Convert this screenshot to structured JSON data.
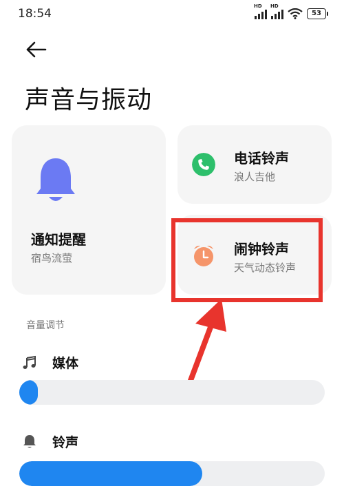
{
  "status_bar": {
    "time": "18:54",
    "hd": "HD",
    "battery": "53"
  },
  "header": {
    "title": "声音与振动"
  },
  "cards": {
    "notification": {
      "title": "通知提醒",
      "subtitle": "宿鸟流萤"
    },
    "ringtone": {
      "title": "电话铃声",
      "subtitle": "浪人吉他"
    },
    "alarm": {
      "title": "闹钟铃声",
      "subtitle": "天气动态铃声"
    }
  },
  "volume": {
    "section_label": "音量调节",
    "media": {
      "label": "媒体",
      "level": 0.06
    },
    "ring": {
      "label": "铃声",
      "level": 0.6
    }
  },
  "colors": {
    "accent_blue": "#1f86f0",
    "bell_purple": "#6b7af3",
    "phone_green": "#2dbf6b",
    "alarm_orange": "#f5956a",
    "annotation_red": "#e8342d"
  },
  "icons": [
    "back-arrow-icon",
    "bell-icon",
    "phone-icon",
    "alarm-clock-icon",
    "music-note-icon",
    "small-bell-icon",
    "wifi-icon",
    "signal-icon",
    "battery-icon"
  ]
}
